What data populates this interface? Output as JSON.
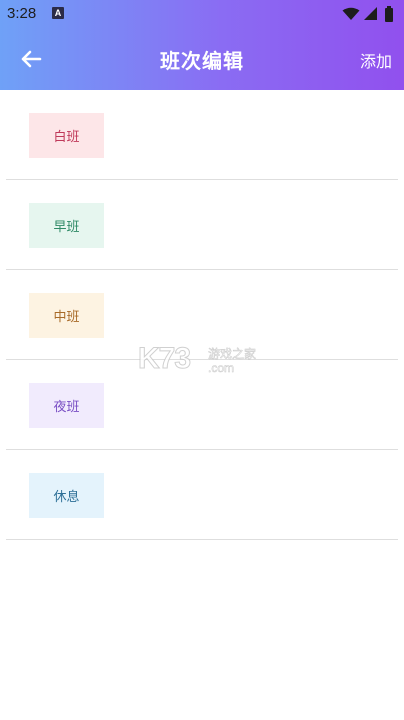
{
  "status_bar": {
    "time": "3:28",
    "app_icon_letter": "A"
  },
  "toolbar": {
    "title": "班次编辑",
    "add_label": "添加",
    "back_icon": "arrow-left-icon"
  },
  "shifts": [
    {
      "label": "白班",
      "bg": "#fde6e8",
      "color": "#c0395a"
    },
    {
      "label": "早班",
      "bg": "#e6f6ef",
      "color": "#2f8a66"
    },
    {
      "label": "中班",
      "bg": "#fdf3e2",
      "color": "#a86a28"
    },
    {
      "label": "夜班",
      "bg": "#f1ebfd",
      "color": "#7a4fc4"
    },
    {
      "label": "休息",
      "bg": "#e4f3fc",
      "color": "#2d6f97"
    }
  ],
  "watermark": {
    "logo_text": "K73",
    "tagline": "游戏之家",
    "domain": ".com"
  },
  "colors": {
    "header_gradient_start": "#6fa1f7",
    "header_gradient_end": "#9150ee",
    "divider": "#dedede"
  }
}
